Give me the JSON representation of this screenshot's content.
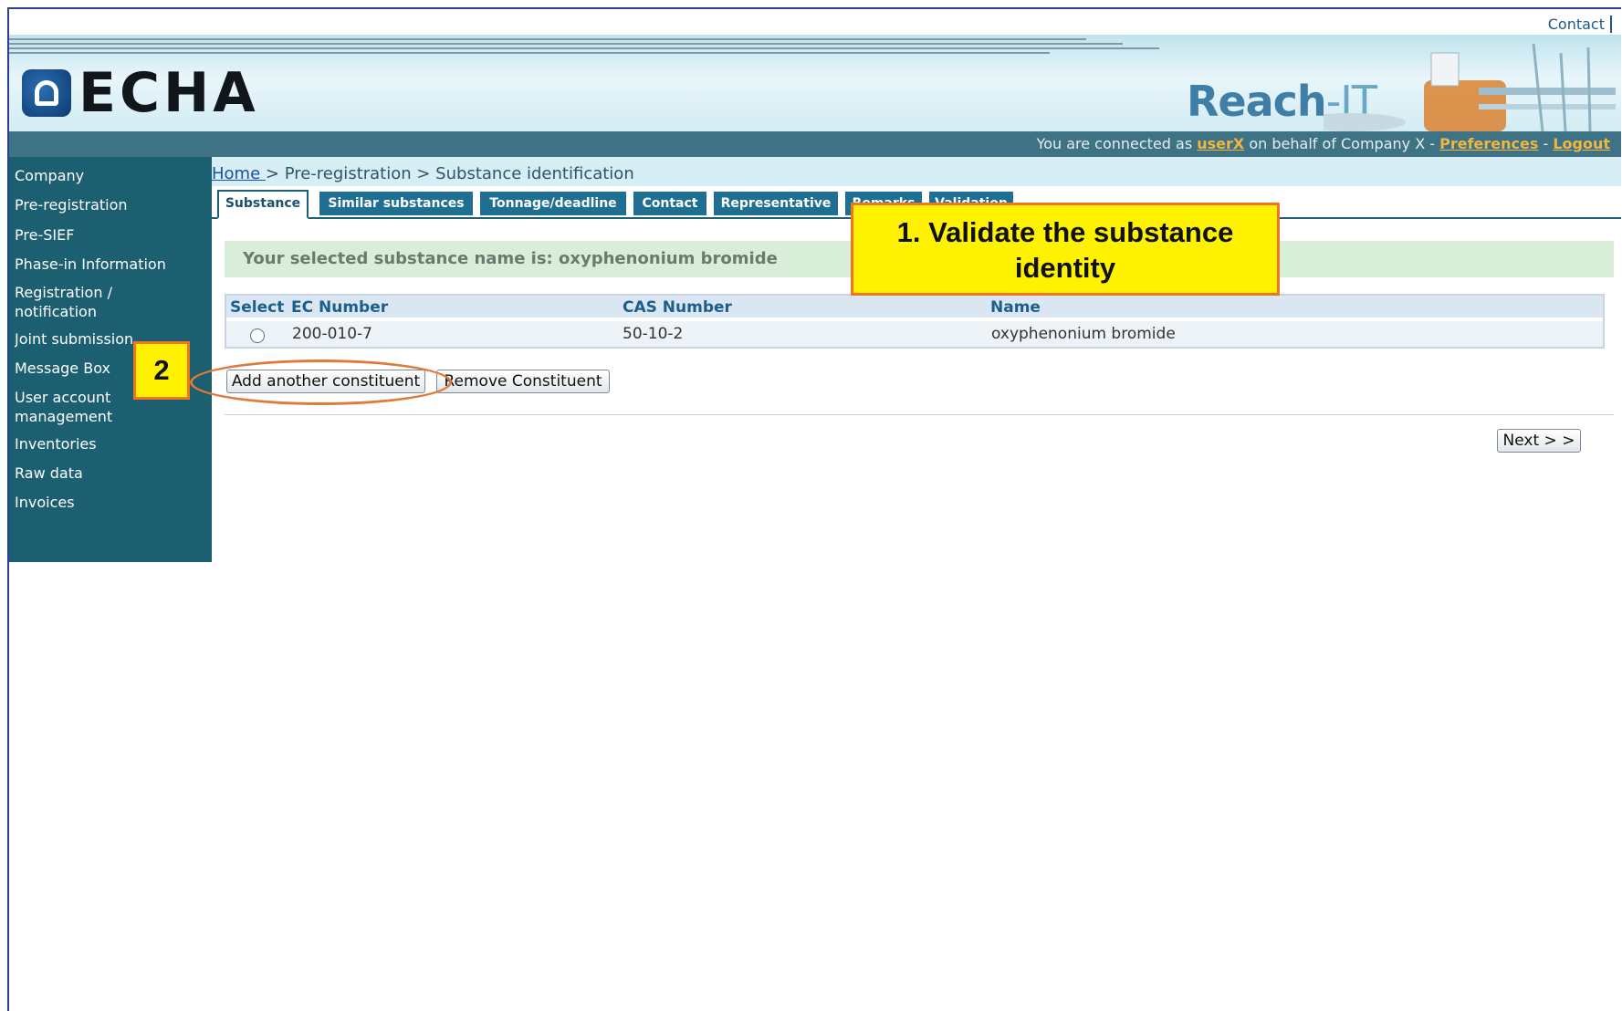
{
  "header": {
    "contact_label": "Contact",
    "logo_text": "ECHA",
    "product_name_main": "Reach",
    "product_name_suffix": "-IT",
    "connected_prefix": "You are connected as ",
    "user": "userX",
    "connected_middle": " on behalf of Company X - ",
    "preferences": "Preferences",
    "separator": " - ",
    "logout": "Logout"
  },
  "sidebar": {
    "items": [
      {
        "label": "Company"
      },
      {
        "label": "Pre-registration"
      },
      {
        "label": "Pre-SIEF"
      },
      {
        "label": "Phase-in Information"
      },
      {
        "label": "Registration / notification"
      },
      {
        "label": "Joint submission"
      },
      {
        "label": "Message Box"
      },
      {
        "label": "User account management"
      },
      {
        "label": "Inventories"
      },
      {
        "label": "Raw data"
      },
      {
        "label": "Invoices"
      }
    ]
  },
  "breadcrumb": {
    "home": "Home ",
    "rest": "> Pre-registration > Substance identification"
  },
  "tabs": [
    {
      "label": "Substance",
      "active": true
    },
    {
      "label": "Similar substances",
      "active": false
    },
    {
      "label": "Tonnage/deadline",
      "active": false
    },
    {
      "label": "Contact",
      "active": false
    },
    {
      "label": "Representative",
      "active": false
    },
    {
      "label": "Remarks",
      "active": false
    },
    {
      "label": "Validation",
      "active": false
    }
  ],
  "notice": "Your selected substance name is: oxyphenonium bromide",
  "table": {
    "columns": [
      "Select",
      "EC Number",
      "CAS Number",
      "Name"
    ],
    "rows": [
      {
        "selected": false,
        "ec_number": "200-010-7",
        "cas_number": "50-10-2",
        "name": "oxyphenonium bromide"
      }
    ]
  },
  "buttons": {
    "add_constituent": "Add another constituent",
    "remove_constituent": "Remove Constituent",
    "next": "Next > >"
  },
  "annotations": {
    "callout_1_line1": "1. Validate the substance",
    "callout_1_line2": "identity",
    "callout_2": "2"
  },
  "colors": {
    "sidebar": "#1c5f70",
    "tab": "#1e6f91",
    "callout_fill": "#fff200",
    "callout_border": "#ee7524"
  }
}
